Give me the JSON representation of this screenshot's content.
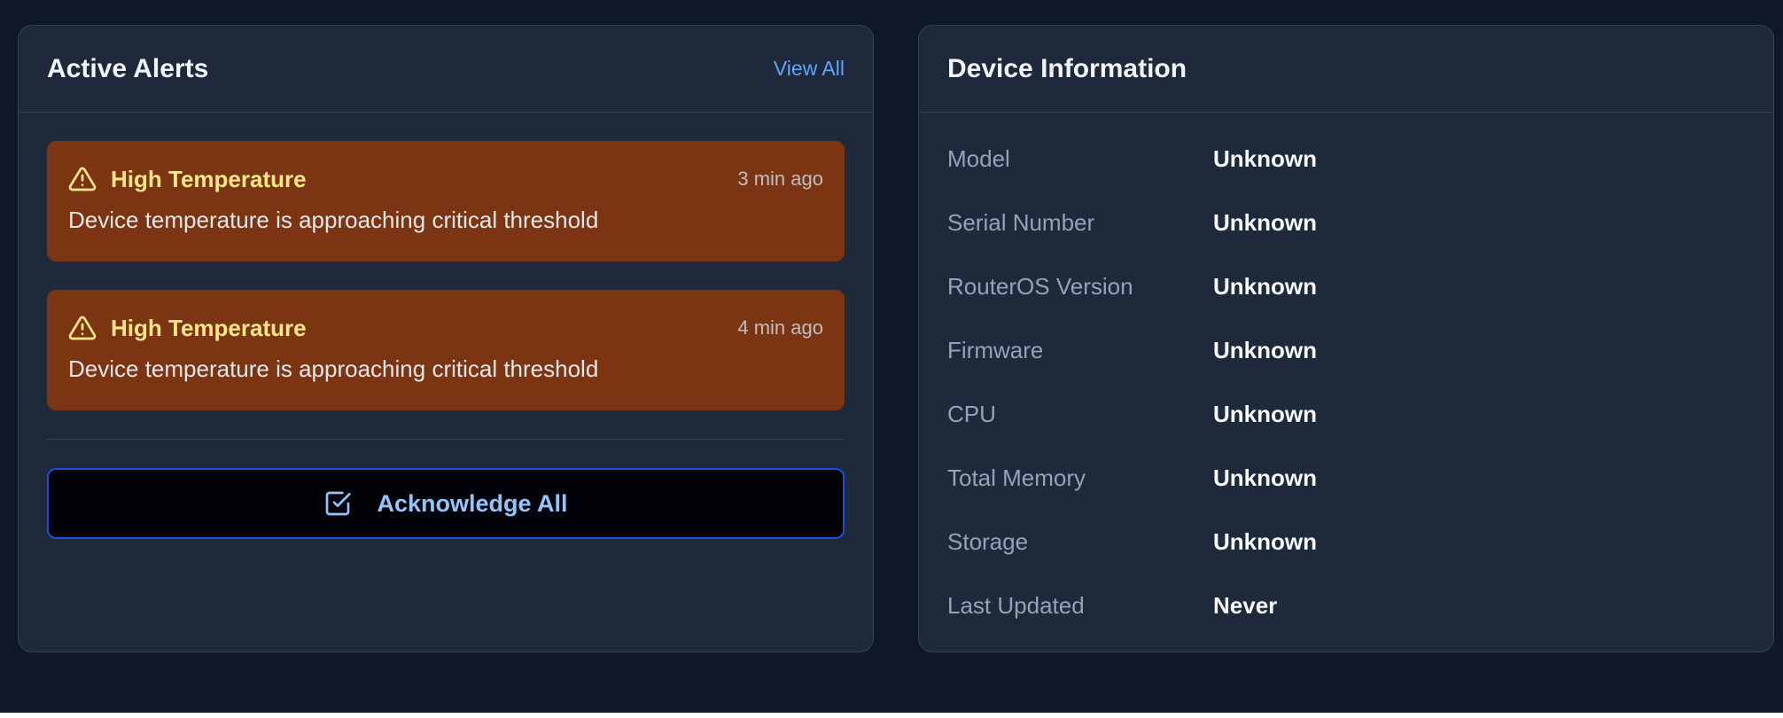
{
  "alerts_card": {
    "title": "Active Alerts",
    "view_all_label": "View All",
    "alerts": [
      {
        "icon": "warning-triangle-icon",
        "title": "High Temperature",
        "time": "3 min ago",
        "message": "Device temperature is approaching critical threshold"
      },
      {
        "icon": "warning-triangle-icon",
        "title": "High Temperature",
        "time": "4 min ago",
        "message": "Device temperature is approaching critical threshold"
      }
    ],
    "acknowledge_label": "Acknowledge All",
    "acknowledge_icon": "check-square-icon"
  },
  "device_card": {
    "title": "Device Information",
    "rows": [
      {
        "label": "Model",
        "value": "Unknown"
      },
      {
        "label": "Serial Number",
        "value": "Unknown"
      },
      {
        "label": "RouterOS Version",
        "value": "Unknown"
      },
      {
        "label": "Firmware",
        "value": "Unknown"
      },
      {
        "label": "CPU",
        "value": "Unknown"
      },
      {
        "label": "Total Memory",
        "value": "Unknown"
      },
      {
        "label": "Storage",
        "value": "Unknown"
      },
      {
        "label": "Last Updated",
        "value": "Never"
      }
    ]
  },
  "colors": {
    "page_background": "#0f172a",
    "card_background": "#1e293b",
    "alert_background": "#7c3512",
    "alert_title": "#fde68a",
    "accent_link": "#60a5fa",
    "button_border": "#1d4ed8"
  }
}
